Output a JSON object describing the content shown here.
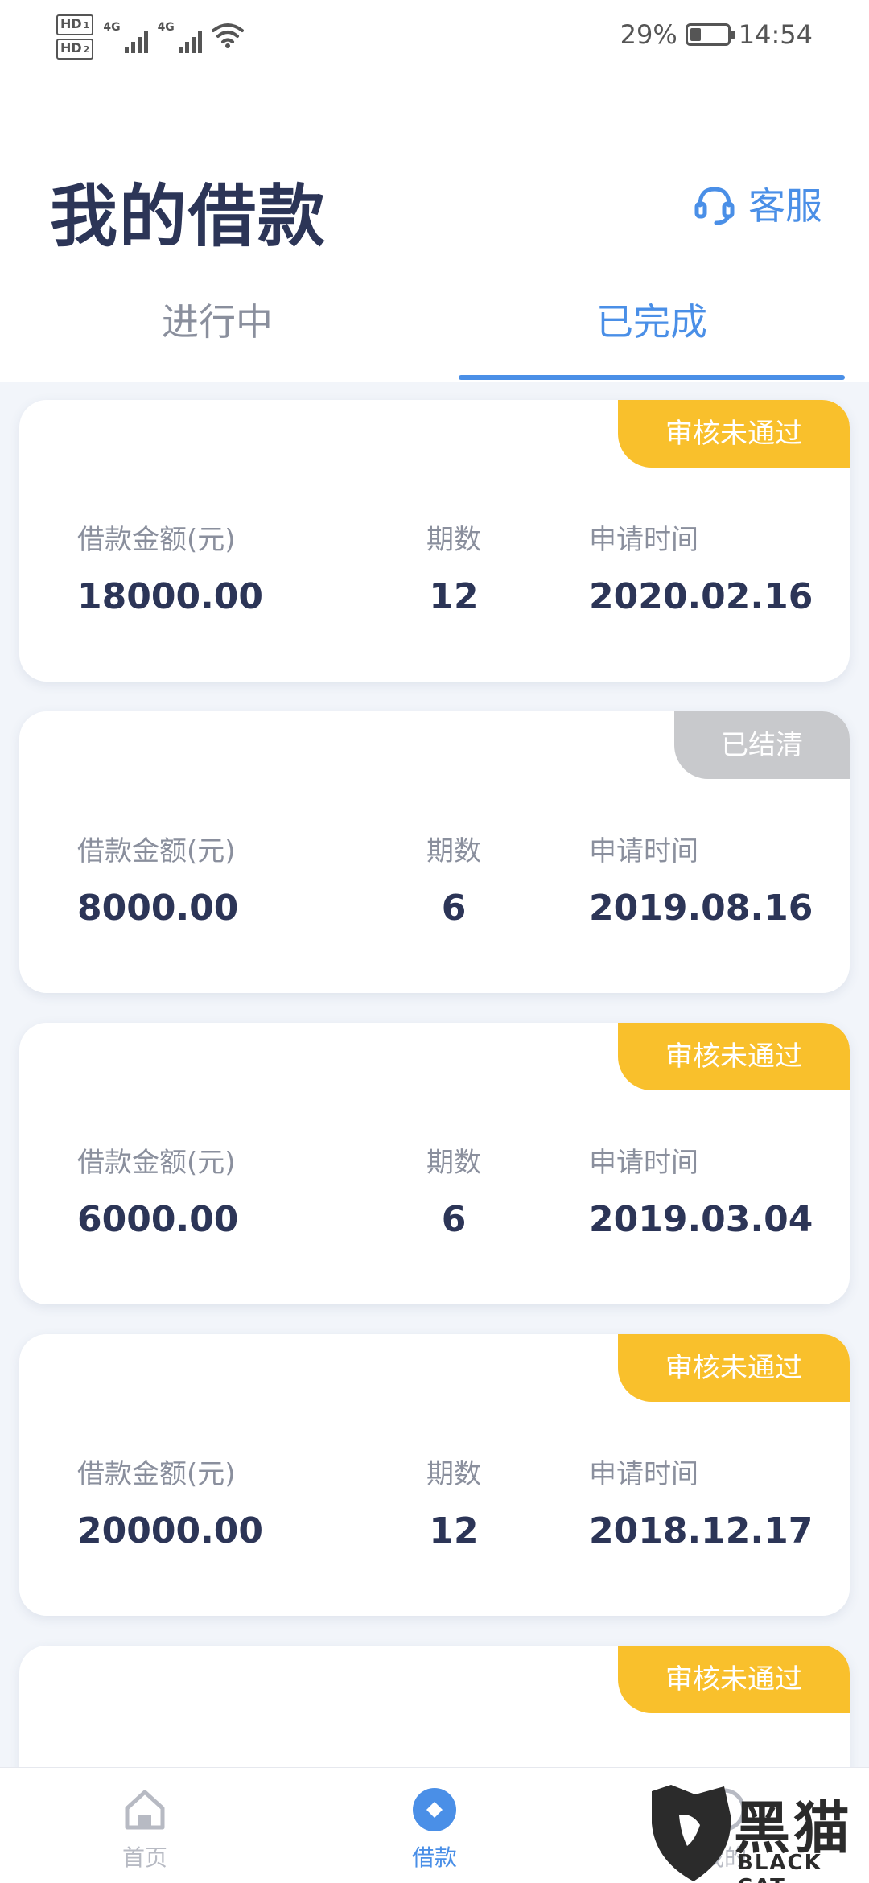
{
  "status_bar": {
    "hd1": "HD",
    "hd1_sub": "1",
    "hd2": "HD",
    "hd2_sub": "2",
    "net1": "4G",
    "net2": "4G",
    "battery_percent_text": "29%",
    "battery_level": 0.29,
    "time": "14:54",
    "icons": [
      "signal-icon",
      "wifi-icon",
      "battery-icon"
    ]
  },
  "header": {
    "title": "我的借款",
    "customer_service_label": "客服",
    "customer_service_icon": "headset-icon"
  },
  "tabs": [
    {
      "label": "进行中",
      "active": false
    },
    {
      "label": "已完成",
      "active": true
    }
  ],
  "loans": [
    {
      "status": "审核未通过",
      "status_type": "rejected",
      "amount_label": "借款金额(元)",
      "amount": "18000.00",
      "terms_label": "期数",
      "terms": "12",
      "date_label": "申请时间",
      "date": "2020.02.16"
    },
    {
      "status": "已结清",
      "status_type": "settled",
      "amount_label": "借款金额(元)",
      "amount": "8000.00",
      "terms_label": "期数",
      "terms": "6",
      "date_label": "申请时间",
      "date": "2019.08.16"
    },
    {
      "status": "审核未通过",
      "status_type": "rejected",
      "amount_label": "借款金额(元)",
      "amount": "6000.00",
      "terms_label": "期数",
      "terms": "6",
      "date_label": "申请时间",
      "date": "2019.03.04"
    },
    {
      "status": "审核未通过",
      "status_type": "rejected",
      "amount_label": "借款金额(元)",
      "amount": "20000.00",
      "terms_label": "期数",
      "terms": "12",
      "date_label": "申请时间",
      "date": "2018.12.17"
    },
    {
      "status": "审核未通过",
      "status_type": "rejected"
    }
  ],
  "bottom_nav": {
    "home": {
      "label": "首页",
      "icon": "home-icon"
    },
    "loan": {
      "label": "借款",
      "icon": "loan-icon"
    },
    "mine": {
      "label": "我的",
      "icon": "user-icon"
    }
  },
  "watermark": {
    "cn": "黑猫",
    "en": "BLACK CAT"
  },
  "colors": {
    "accent": "#4a8fe7",
    "rejected": "#f9c02c",
    "settled": "#c8c9cc",
    "text_dark": "#2c3557",
    "text_muted": "#8a8f9d"
  }
}
